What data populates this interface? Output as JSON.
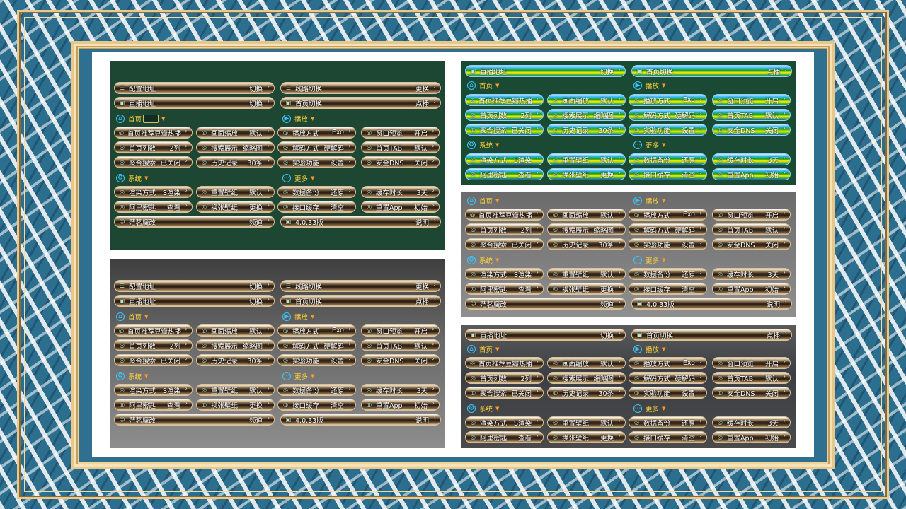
{
  "labels": {
    "config_addr": "配置地址",
    "line_switch": "线路切换",
    "live_addr": "直播地址",
    "home_switch": "首页切换",
    "switch": "切换",
    "change": "更换",
    "vod": "点播",
    "home": "首页",
    "play": "播放",
    "system": "系统",
    "more": "更多",
    "home_rec": "首页推荐",
    "douban": "豆瓣热播",
    "scale": "画面缩放",
    "default": "默认",
    "play_mode": "播放方式",
    "exo": "Exo",
    "win_preview": "窗口预览",
    "on": "开启",
    "home_cols": "首页列数",
    "two_cols": "2列",
    "search_show": "搜索展示",
    "thumb": "缩略图",
    "decode": "解码方式",
    "hw_decode": "硬解码",
    "home_tab": "首页TAB",
    "agg_search": "聚合搜索",
    "closed": "已关闭",
    "history": "历史记录",
    "thirty": "30条",
    "lab": "实验功能",
    "settings": "设置",
    "safe_dns": "安全DNS",
    "off": "关闭",
    "render": "渲染方式",
    "s_render": "S渲染",
    "reset_wp": "重置壁纸",
    "backup": "数据备份",
    "restore": "还原",
    "cache_time": "缓存时长",
    "three_days": "3天",
    "ali_token": "阿里密匙",
    "view": "查看",
    "change_wp": "换张壁纸",
    "api_cache": "接口缓存",
    "clear": "清空",
    "reset_app": "重置App",
    "init": "初始",
    "mingmo": "茫茗魔改",
    "channel": "频道",
    "version": "4.0.33版",
    "explain": "说明"
  }
}
